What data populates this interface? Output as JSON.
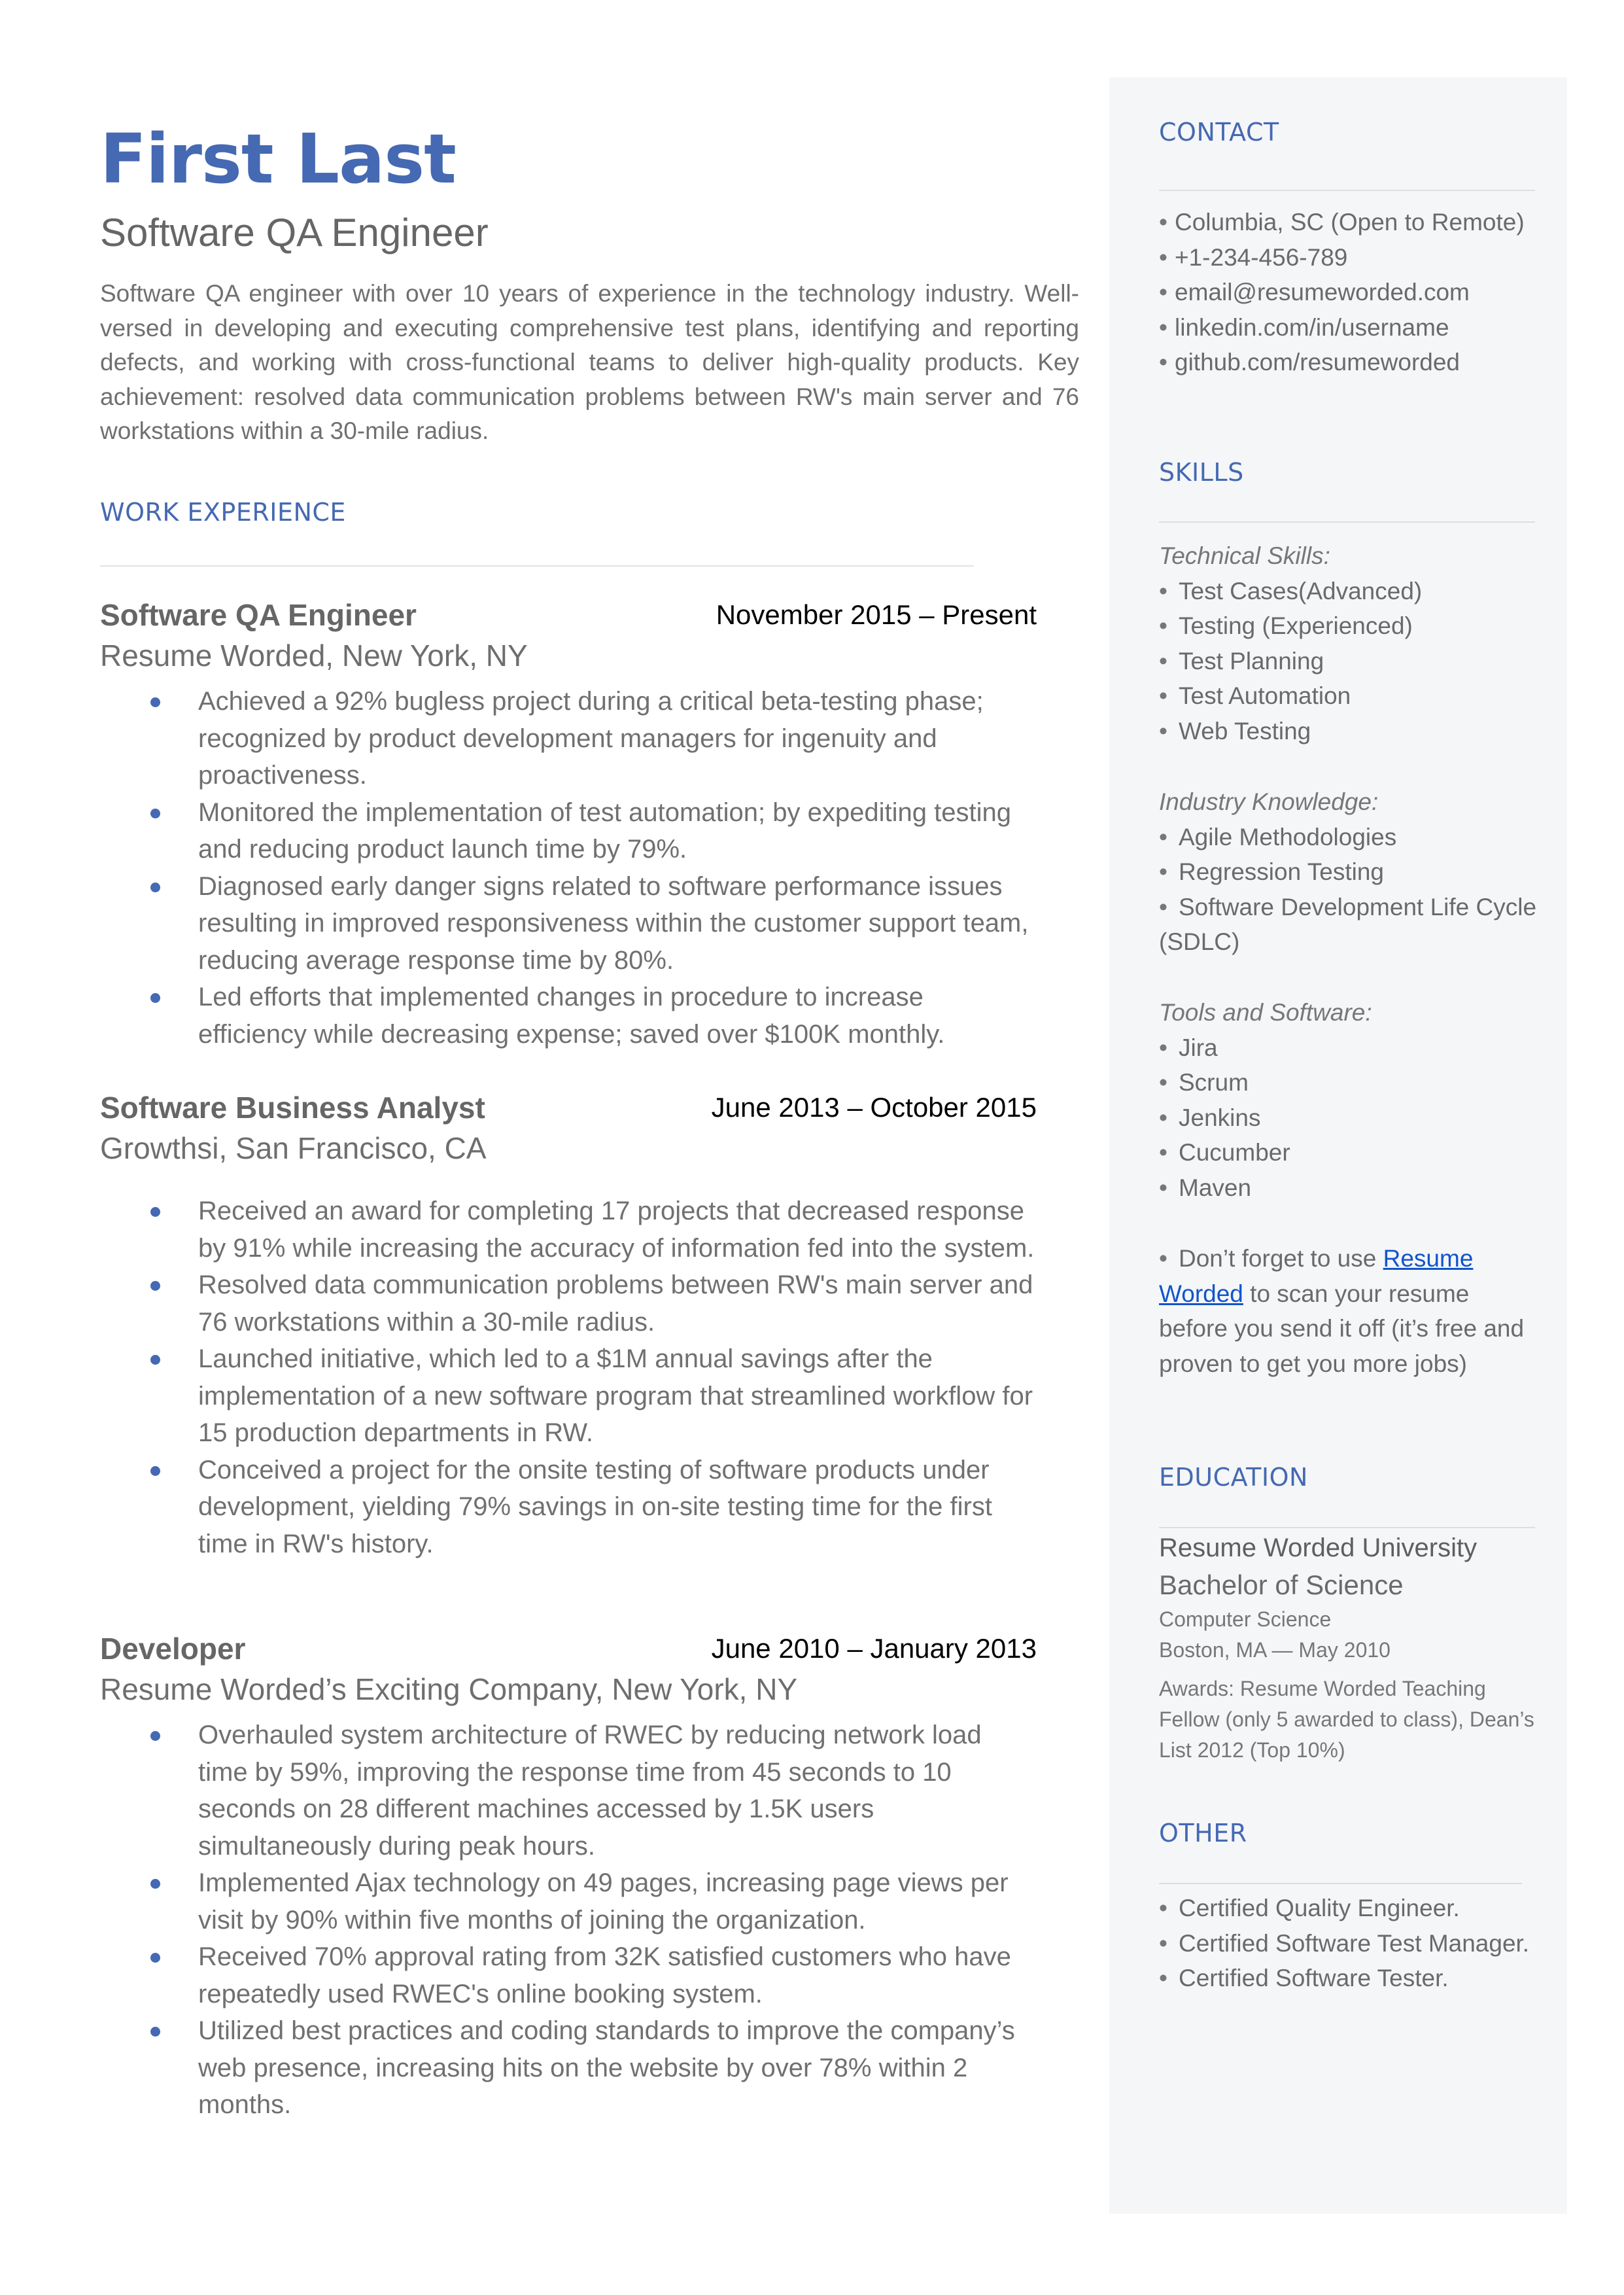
{
  "header": {
    "name": "First Last",
    "role": "Software QA Engineer",
    "summary": "Software QA engineer with over 10 years of experience in the technology industry. Well-versed in developing and executing comprehensive test plans, identifying and reporting defects, and working with cross-functional teams to deliver high-quality products. Key achievement: resolved data communication problems between RW's main server and 76 workstations within a 30-mile radius."
  },
  "colors": {
    "accent": "#4569b2",
    "sidebar_bg": "#f5f6f8",
    "link": "#1155cc",
    "body_text": "#6a6a6a"
  },
  "work": {
    "title": "WORK EXPERIENCE",
    "jobs": [
      {
        "title": "Software QA Engineer",
        "dates": "November 2015 – Present",
        "company": "Resume Worded, New York, NY",
        "bullets": [
          "Achieved a 92% bugless project during a critical beta-testing phase; recognized by product development managers for ingenuity and proactiveness.",
          "Monitored the implementation of test automation; by expediting testing and reducing product launch time by 79%.",
          "Diagnosed early danger signs related to software performance issues resulting in improved responsiveness within the customer support team, reducing average response time by 80%.",
          "Led efforts that implemented changes in procedure to increase efficiency while decreasing expense; saved over $100K monthly."
        ]
      },
      {
        "title": "Software Business Analyst",
        "dates": "June 2013 – October 2015",
        "company": "Growthsi, San Francisco, CA",
        "bullets": [
          "Received an award for completing 17 projects that decreased response by 91% while increasing the accuracy of information fed into the system.",
          "Resolved data communication problems between RW's main server and 76 workstations within a 30-mile radius.",
          "Launched initiative, which led to a $1M annual savings after the implementation of a new software program that streamlined workflow for 15 production departments in RW.",
          "Conceived a project for the onsite testing of software products under development, yielding 79% savings in on-site testing time for the first time in RW's history."
        ]
      },
      {
        "title": "Developer",
        "dates": "June 2010 – January 2013",
        "company": "Resume Worded’s Exciting Company, New York, NY",
        "bullets": [
          "Overhauled system architecture of RWEC by reducing network load time by 59%, improving the response time from 45 seconds to 10 seconds on 28 different machines accessed by 1.5K users simultaneously during peak hours.",
          "Implemented Ajax technology on 49 pages, increasing page views per visit by 90% within five months of joining the organization.",
          "Received 70% approval rating from 32K satisfied customers who have repeatedly used RWEC's online booking system.",
          "Utilized best practices and coding standards to improve the company’s web presence, increasing hits on the website by over 78% within 2 months."
        ]
      }
    ]
  },
  "sidebar": {
    "contact": {
      "title": "CONTACT",
      "bullet": "•",
      "items": [
        "Columbia, SC (Open to Remote)",
        "+1-234-456-789",
        "email@resumeworded.com",
        "linkedin.com/in/username",
        "github.com/resumeworded"
      ]
    },
    "skills": {
      "title": "SKILLS",
      "bullet": "•",
      "groups": [
        {
          "label": "Technical Skills:",
          "items": [
            "Test Cases(Advanced)",
            "Testing (Experienced)",
            "Test Planning",
            "Test Automation",
            "Web Testing"
          ]
        },
        {
          "label": "Industry Knowledge:",
          "items": [
            "Agile Methodologies",
            "Regression Testing",
            "Software Development Life Cycle (SDLC)"
          ]
        },
        {
          "label": "Tools and Software:",
          "items": [
            "Jira",
            "Scrum",
            "Jenkins",
            "Cucumber",
            "Maven"
          ]
        }
      ],
      "tip": {
        "prefix": "Don’t forget to use ",
        "link_text": "Resume Worded",
        "suffix": " to scan your resume before you send it off (it’s free and proven to get you more jobs)"
      }
    },
    "education": {
      "title": "EDUCATION",
      "school": "Resume Worded University",
      "degree": "Bachelor of Science",
      "field": "Computer Science",
      "location_date": "Boston, MA — May 2010",
      "awards": "Awards: Resume Worded Teaching Fellow (only 5 awarded to class), Dean’s List 2012 (Top 10%)"
    },
    "other": {
      "title": "OTHER",
      "bullet": "•",
      "items": [
        "Certified Quality Engineer.",
        "Certified Software Test Manager.",
        "Certified Software Tester."
      ]
    }
  }
}
